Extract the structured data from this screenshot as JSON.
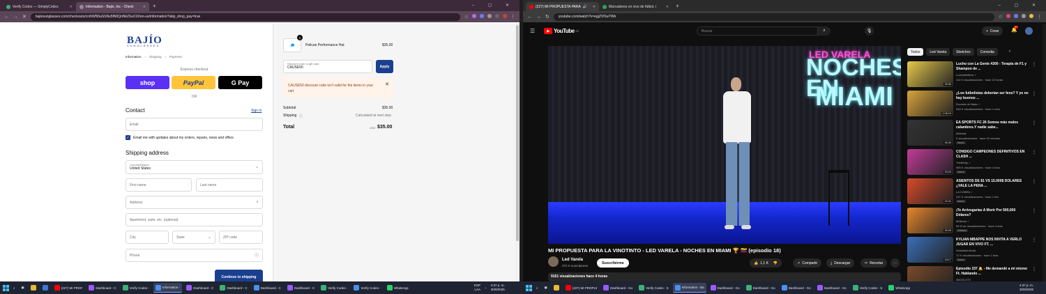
{
  "left_browser": {
    "tabs": [
      {
        "title": "Verify Codes — SimplyCodes",
        "active": false,
        "color": "#3bb273"
      },
      {
        "title": "Information - Bajio, Inc - Check",
        "active": true,
        "color": "#9b8a99"
      }
    ],
    "url": "bajiosunglasses.com/checkouts/cn/hWN5aSSNs5fN0QnNkZ6uX10/en-us/information?skip_shop_pay=true",
    "checkout": {
      "logo": "BAJÍO",
      "logo_sub": "SUNGLASSES",
      "breadcrumbs": [
        "Information",
        "Shipping",
        "Payment"
      ],
      "express_label": "Express checkout",
      "buttons": {
        "shop": "shop",
        "paypal": "PayPal",
        "gpay": "G Pay"
      },
      "or_label": "OR",
      "contact_heading": "Contact",
      "signin": "Sign in",
      "email_placeholder": "Email",
      "newsletter_label": "Email me with updates about my orders, repairs, news and offers",
      "shipping_heading": "Shipping address",
      "country_label": "Country/Region",
      "country_value": "United States",
      "first_name": "First name",
      "last_name": "Last name",
      "address": "Address",
      "apartment": "Apartment, suite, etc. (optional)",
      "city": "City",
      "state": "State",
      "zip": "ZIP code",
      "phone": "Phone",
      "continue": "Continue to shipping"
    },
    "summary": {
      "qty": "1",
      "product": "Pelican Performance Hat",
      "product_price": "$35.00",
      "discount_label": "Discount code or gift card",
      "discount_value": "CAUSE50",
      "apply": "Apply",
      "error": "CAUSE50 discount code isn't valid for the items in your cart",
      "subtotal_label": "Subtotal",
      "subtotal": "$35.00",
      "shipping_label": "Shipping",
      "shipping_value": "Calculated at next step",
      "total_label": "Total",
      "currency": "USD",
      "total": "$35.00"
    }
  },
  "right_browser": {
    "tabs": [
      {
        "title": "(227) MI PROPUESTA PARA",
        "active": true,
        "color": "#ff0000"
      },
      {
        "title": "Marcadores en vivo de fútbol, i",
        "active": false,
        "color": "#2fa35a"
      }
    ],
    "url": "youtube.com/watch?v=egjZVf1wTWk",
    "youtube": {
      "logo": "YouTube",
      "region": "CO",
      "search_placeholder": "Buscar",
      "create": "Crear",
      "notif_count": "9+",
      "video": {
        "overlay_line1": "LED VARELA",
        "overlay_line2": "NOCHES EN",
        "overlay_line3": "MIAMI",
        "title": "MI PROPUESTA PARA LA VINOTINTO - LED VARELA - NOCHES EN MIAMI 🏆 🇻🇪 (episodio 18)",
        "channel": "Led Varela",
        "subs": "372 K suscriptores",
        "subscribe": "Suscribirme",
        "likes": "1,1 K",
        "share": "Compartir",
        "download": "Descargar",
        "clip": "Recortar",
        "views": "9151 visualizaciones  hace 4 horas"
      },
      "chips": [
        "Todos",
        "Led Varela",
        "Sketches",
        "Comedia"
      ],
      "recommendations": [
        {
          "title": "Lucho con La Gente #200 - Terapia de F1 y Shampoo de ...",
          "channel": "LuchoMelitera ✓",
          "meta": "114 K visualizaciones · hace 22 horas",
          "duration": "39:55",
          "badge": "",
          "color": "#e7c94a"
        },
        {
          "title": "¿Los futbolistas deberían ser feos? Y yo no hay buenos ...",
          "channel": "Escuela de Nada ✓",
          "meta": "264 K visualizaciones · hace 1 mes",
          "duration": "1:08:19",
          "badge": "",
          "color": "#d9a43a"
        },
        {
          "title": "EA SPORTS FC 26 Somos más malos calambres.Y nadie sabe...",
          "channel": "Mekaria",
          "meta": "0 visualizaciones · hace 22 minutos",
          "duration": "46:43",
          "badge": "Nuevo",
          "color": "#333"
        },
        {
          "title": "CONSIGO CAMPEONES DEFINITIVOS EN CLASH ...",
          "channel": "TheBrelly ✓",
          "meta": "985 K visualizaciones · hace 4 días",
          "duration": "33:23",
          "badge": "Nuevo",
          "color": "#c23c9a"
        },
        {
          "title": "ASIENTOS DE $1 VS 15.000$ DÓLARES ¿VALE LA PENA ...",
          "channel": "LA COBRA ✓",
          "meta": "241 K visualizaciones · hace 1 día",
          "duration": "22:41",
          "badge": "Nuevo",
          "color": "#d84a2a"
        },
        {
          "title": "¡Te Arriesgarías A Morir Por 500,000 Dólares?",
          "channel": "MrBeast ✓",
          "meta": "54 M de visualizaciones · hace 3 días",
          "duration": "25:25",
          "badge": "Doblado",
          "color": "#e6862e"
        },
        {
          "title": "KYLIAN MBAPPE NOS INVITA A VERLO JUGAR EN VIVO FT. ...",
          "channel": "Sebastián Abad",
          "meta": "72 K visualizaciones · hace 2 días",
          "duration": "18:17",
          "badge": "Nuevo",
          "color": "#3b6fb8"
        },
        {
          "title": "Episodio 337 🔔 - Me demandé a mi mismo Ft. Hablando ...",
          "channel": "3BOOLSTV",
          "meta": "",
          "duration": "",
          "badge": "",
          "color": "#7a4a2a"
        }
      ]
    }
  },
  "taskbar_left": {
    "items": [
      "(227) MI PROF",
      "Dashboard - C",
      "Verify Codes -",
      "Information -",
      "Dashboard - C",
      "Dashboard - C",
      "Dashboard - C",
      "Dashboard - C",
      "Verify Codes -",
      "Verify Codes -",
      "WhatsApp"
    ],
    "lang": "ESP",
    "lang2": "LAA",
    "time": "4:37 p. m.",
    "date": "30/9/2025"
  },
  "taskbar_right": {
    "items": [
      "(227) MI PROPUI",
      "Dashboard - Go",
      "Verify Codes - S",
      "Information - Ba",
      "Dashboard - Go",
      "Dashboard - Go",
      "Dashboard - Go",
      "Dashboard - Go",
      "Verify Codes - S",
      "WhatsApp"
    ],
    "time": "4:37 p. m.",
    "date": "30/9/2025"
  }
}
